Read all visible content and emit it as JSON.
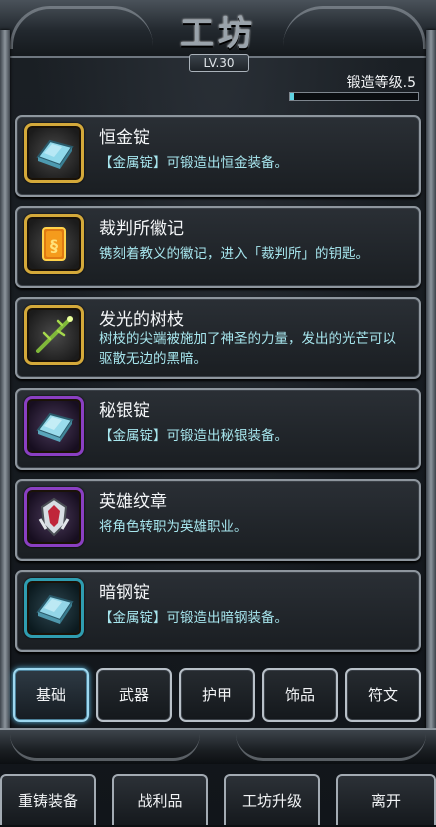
{
  "header": {
    "title": "工坊",
    "level": "LV.30",
    "forge_label": "锻造等级.5",
    "forge_progress": 0.03
  },
  "items": [
    {
      "name": "恒金锭",
      "desc": "【金属锭】可锻造出恒金装备。",
      "icon": "ingot-icon",
      "frame": "gold"
    },
    {
      "name": "裁判所徽记",
      "desc": "镌刻着教义的徽记，进入「裁判所」的钥匙。",
      "icon": "emblem-icon",
      "frame": "gold"
    },
    {
      "name": "发光的树枝",
      "desc": "树枝的尖端被施加了神圣的力量，发出的光芒可以驱散无边的黑暗。",
      "icon": "branch-icon",
      "frame": "gold"
    },
    {
      "name": "秘银锭",
      "desc": "【金属锭】可锻造出秘银装备。",
      "icon": "ingot-icon",
      "frame": "purple"
    },
    {
      "name": "英雄纹章",
      "desc": "将角色转职为英雄职业。",
      "icon": "crest-icon",
      "frame": "purple"
    },
    {
      "name": "暗钢锭",
      "desc": "【金属锭】可锻造出暗钢装备。",
      "icon": "ingot-icon",
      "frame": "teal"
    }
  ],
  "tabs": [
    {
      "label": "基础",
      "active": true
    },
    {
      "label": "武器",
      "active": false
    },
    {
      "label": "护甲",
      "active": false
    },
    {
      "label": "饰品",
      "active": false
    },
    {
      "label": "符文",
      "active": false
    }
  ],
  "bottom_buttons": [
    {
      "label": "重铸装备"
    },
    {
      "label": "战利品"
    },
    {
      "label": "工坊升级"
    },
    {
      "label": "离开"
    }
  ]
}
